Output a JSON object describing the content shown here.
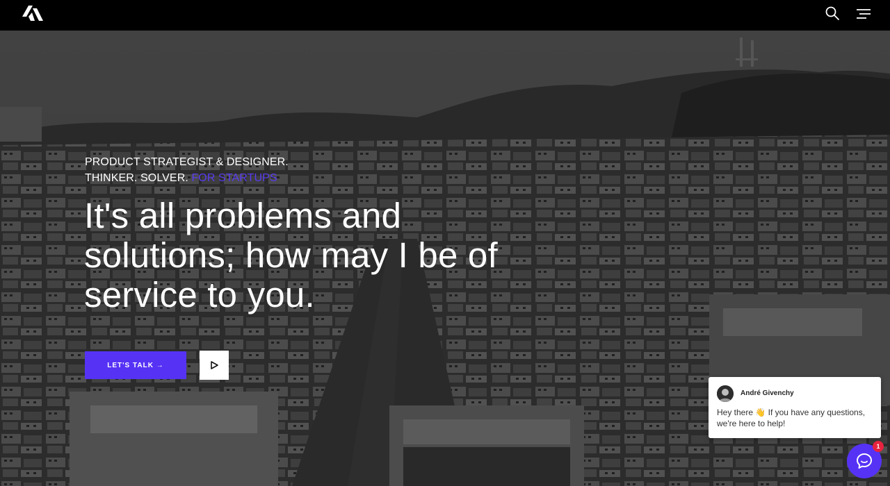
{
  "header": {
    "logo_icon": "slanted-bars-logo-icon",
    "search_icon": "search-icon",
    "menu_icon": "hamburger-menu-icon"
  },
  "hero": {
    "tagline_line1": "PRODUCT STRATEGIST & DESIGNER.",
    "tagline_line2": "THINKER. SOLVER.",
    "tagline_accent": "FOR STARTUPS",
    "headline_lines": [
      "It's all problems and",
      "solutions; how may I be of",
      "service to you."
    ],
    "cta_label": "LET'S TALK →",
    "play_icon": "play-icon",
    "scroll_icon": "mouse-scroll-icon"
  },
  "chat": {
    "agent_name": "André Givenchy",
    "message": "Hey there 👋  If you have any questions, we're here to help!",
    "unread_count": "1",
    "launcher_icon": "chat-bubble-icon"
  },
  "colors": {
    "accent": "#5632f5",
    "accent_text": "#5a3cf0",
    "badge": "#e8233f",
    "topbar": "#000000"
  }
}
